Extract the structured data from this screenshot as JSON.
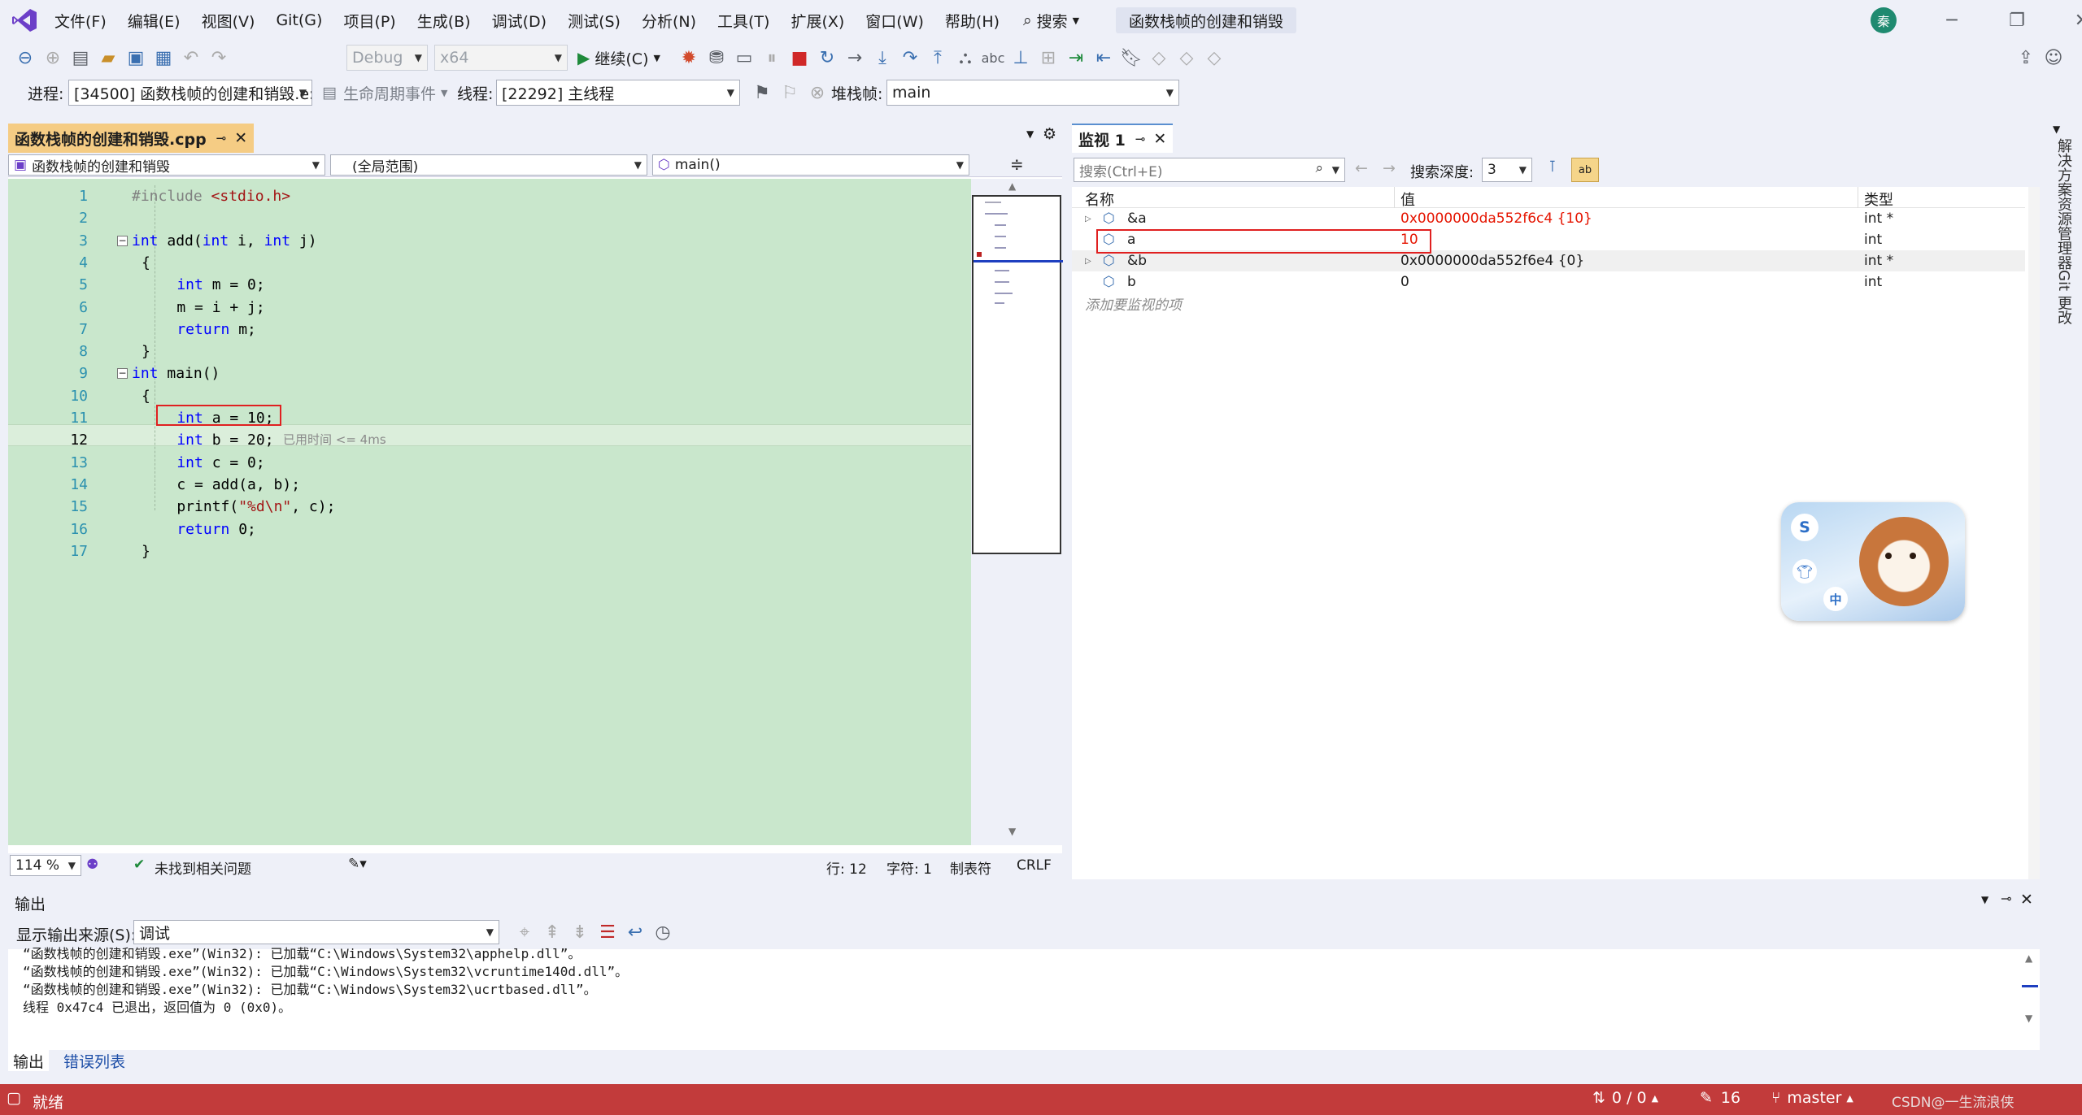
{
  "menubar": {
    "items": [
      "文件(F)",
      "编辑(E)",
      "视图(V)",
      "Git(G)",
      "项目(P)",
      "生成(B)",
      "调试(D)",
      "测试(S)",
      "分析(N)",
      "工具(T)",
      "扩展(X)",
      "窗口(W)",
      "帮助(H)"
    ],
    "search_label": "搜索",
    "title": "函数栈帧的创建和销毁",
    "avatar_initial": "秦"
  },
  "toolbar": {
    "config": "Debug",
    "platform": "x64",
    "continue_label": "继续(C)"
  },
  "debug_toolbar": {
    "process_label": "进程:",
    "process_value": "[34500] 函数栈帧的创建和销毁.e:",
    "lifecycle_label": "生命周期事件",
    "thread_label": "线程:",
    "thread_value": "[22292] 主线程",
    "stackframe_label": "堆栈帧:",
    "stackframe_value": "main"
  },
  "editor": {
    "tab_title": "函数栈帧的创建和销毁.cpp",
    "nav_project": "函数栈帧的创建和销毁",
    "nav_scope": "(全局范围)",
    "nav_function": "main()",
    "line_numbers": [
      "1",
      "2",
      "3",
      "4",
      "5",
      "6",
      "7",
      "8",
      "9",
      "10",
      "11",
      "12",
      "13",
      "14",
      "15",
      "16",
      "17"
    ],
    "code_lines": [
      {
        "parts": [
          {
            "t": "#include ",
            "c": "pp"
          },
          {
            "t": "<stdio.h>",
            "c": "str"
          }
        ]
      },
      {
        "parts": []
      },
      {
        "parts": [
          {
            "t": "int",
            "c": "kw"
          },
          {
            "t": " add(",
            "c": ""
          },
          {
            "t": "int",
            "c": "kw"
          },
          {
            "t": " i, ",
            "c": ""
          },
          {
            "t": "int",
            "c": "kw"
          },
          {
            "t": " j)",
            "c": ""
          }
        ]
      },
      {
        "parts": [
          {
            "t": "{",
            "c": ""
          }
        ]
      },
      {
        "parts": [
          {
            "t": "    int",
            "c": "kw"
          },
          {
            "t": " m = 0;",
            "c": ""
          }
        ]
      },
      {
        "parts": [
          {
            "t": "    m = i + j;",
            "c": ""
          }
        ]
      },
      {
        "parts": [
          {
            "t": "    return",
            "c": "kw"
          },
          {
            "t": " m;",
            "c": ""
          }
        ]
      },
      {
        "parts": [
          {
            "t": "}",
            "c": ""
          }
        ]
      },
      {
        "parts": [
          {
            "t": "int",
            "c": "kw"
          },
          {
            "t": " main()",
            "c": ""
          }
        ]
      },
      {
        "parts": [
          {
            "t": "{",
            "c": ""
          }
        ]
      },
      {
        "parts": [
          {
            "t": "    int",
            "c": "kw"
          },
          {
            "t": " a = 10;",
            "c": ""
          }
        ]
      },
      {
        "parts": [
          {
            "t": "    int",
            "c": "kw"
          },
          {
            "t": " b = 20;",
            "c": ""
          }
        ]
      },
      {
        "parts": [
          {
            "t": "    int",
            "c": "kw"
          },
          {
            "t": " c = 0;",
            "c": ""
          }
        ]
      },
      {
        "parts": [
          {
            "t": "    c = add(a, b);",
            "c": ""
          }
        ]
      },
      {
        "parts": [
          {
            "t": "    printf(",
            "c": ""
          },
          {
            "t": "\"%d\\n\"",
            "c": "str"
          },
          {
            "t": ", c);",
            "c": ""
          }
        ]
      },
      {
        "parts": [
          {
            "t": "    return",
            "c": "kw"
          },
          {
            "t": " 0;",
            "c": ""
          }
        ]
      },
      {
        "parts": [
          {
            "t": "}",
            "c": ""
          }
        ]
      }
    ],
    "elapsed_hint": "已用时间 <= 4ms",
    "zoom": "114 %",
    "issues": "未找到相关问题",
    "line_pos": "行: 12",
    "char_pos": "字符: 1",
    "indent": "制表符",
    "eol": "CRLF"
  },
  "watch": {
    "tab_title": "监视 1",
    "search_placeholder": "搜索(Ctrl+E)",
    "depth_label": "搜索深度:",
    "depth_value": "3",
    "col_name": "名称",
    "col_value": "值",
    "col_type": "类型",
    "rows": [
      {
        "name": "&a",
        "value": "0x0000000da552f6c4 {10}",
        "type": "int *"
      },
      {
        "name": "a",
        "value": "10",
        "type": "int"
      },
      {
        "name": "&b",
        "value": "0x0000000da552f6e4 {0}",
        "type": "int *"
      },
      {
        "name": "b",
        "value": "0",
        "type": "int"
      }
    ],
    "add_hint": "添加要监视的项"
  },
  "rail": {
    "solution_explorer": "解决方案资源管理器",
    "git_changes": "Git 更改"
  },
  "output": {
    "title": "输出",
    "source_label": "显示输出来源(S):",
    "source_value": "调试",
    "lines": [
      "“函数栈帧的创建和销毁.exe”(Win32): 已加载“C:\\Windows\\System32\\apphelp.dll”。",
      "“函数栈帧的创建和销毁.exe”(Win32): 已加载“C:\\Windows\\System32\\vcruntime140d.dll”。",
      "“函数栈帧的创建和销毁.exe”(Win32): 已加载“C:\\Windows\\System32\\ucrtbased.dll”。",
      "线程 0x47c4 已退出，返回值为 0 (0x0)。"
    ],
    "tab_output": "输出",
    "tab_errors": "错误列表"
  },
  "statusbar": {
    "ready": "就绪",
    "sync": "0 / 0",
    "edits": "16",
    "branch": "master",
    "extra": "CSDN@一生流浪侠",
    "color": "#c23b3b"
  }
}
